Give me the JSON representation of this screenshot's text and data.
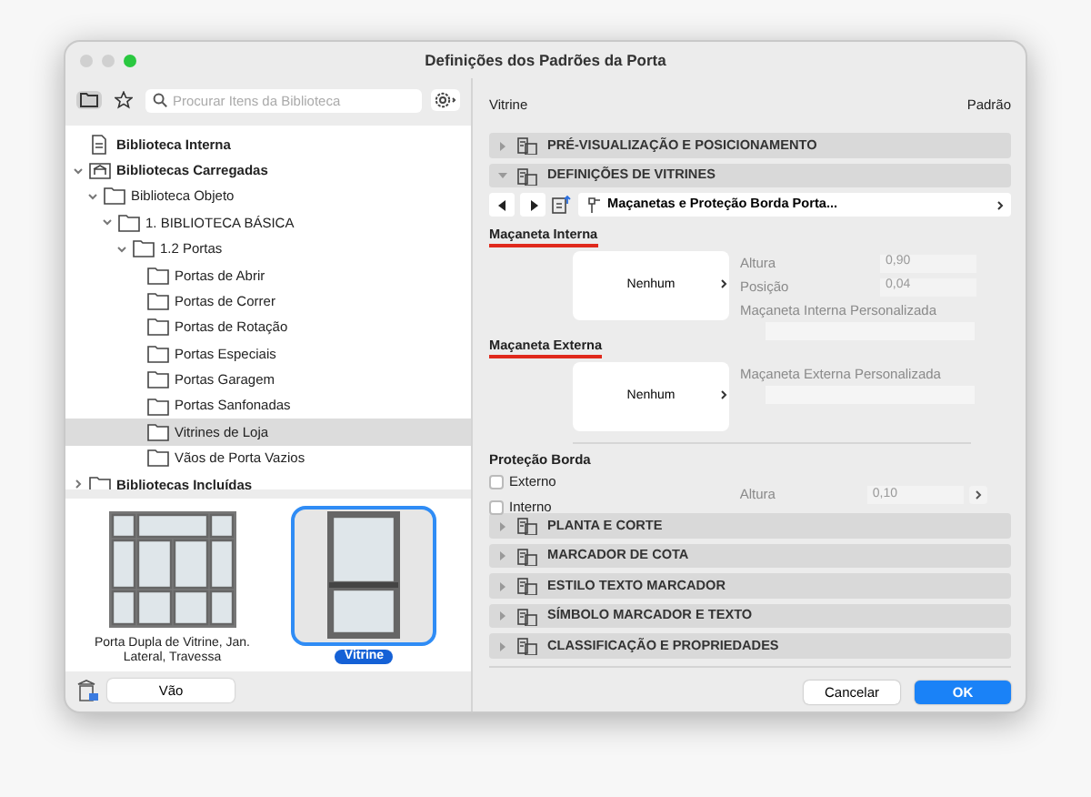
{
  "window": {
    "title": "Definições dos Padrões da Porta"
  },
  "library": {
    "search": {
      "placeholder": "Procurar Itens da Biblioteca"
    },
    "tree": [
      {
        "label": "Biblioteca Interna",
        "kind": "file",
        "bold": true,
        "selected": false
      },
      {
        "label": "Bibliotecas Carregadas",
        "kind": "library",
        "bold": true,
        "selected": false,
        "expanded": true,
        "children": [
          {
            "label": "Biblioteca Objeto",
            "kind": "folder",
            "bold": false,
            "selected": false,
            "expanded": true,
            "children": [
              {
                "label": "1. BIBLIOTECA BÁSICA",
                "kind": "folder",
                "bold": false,
                "selected": false,
                "expanded": true,
                "children": [
                  {
                    "label": "1.2 Portas",
                    "kind": "folder",
                    "bold": false,
                    "selected": false,
                    "expanded": true,
                    "children": [
                      {
                        "label": "Portas de Abrir",
                        "kind": "folder",
                        "bold": false,
                        "selected": false
                      },
                      {
                        "label": "Portas de Correr",
                        "kind": "folder",
                        "bold": false,
                        "selected": false
                      },
                      {
                        "label": "Portas de Rotação",
                        "kind": "folder",
                        "bold": false,
                        "selected": false
                      },
                      {
                        "label": "Portas Especiais",
                        "kind": "folder",
                        "bold": false,
                        "selected": false
                      },
                      {
                        "label": "Portas Garagem",
                        "kind": "folder",
                        "bold": false,
                        "selected": false
                      },
                      {
                        "label": "Portas Sanfonadas",
                        "kind": "folder",
                        "bold": false,
                        "selected": false
                      },
                      {
                        "label": "Vitrines de Loja",
                        "kind": "folder",
                        "bold": false,
                        "selected": true
                      },
                      {
                        "label": "Vãos de Porta Vazios",
                        "kind": "folder",
                        "bold": false,
                        "selected": false
                      }
                    ]
                  }
                ]
              }
            ]
          }
        ]
      },
      {
        "label": "Bibliotecas Incluídas",
        "kind": "folder",
        "bold": true,
        "selected": false,
        "expanded": false
      }
    ],
    "items": [
      {
        "caption": "Porta Dupla de Vitrine, Jan. Lateral, Travessa",
        "kind": "double",
        "selected": false
      },
      {
        "caption": "Vitrine",
        "kind": "single",
        "selected": true
      }
    ],
    "opening_button": "Vão"
  },
  "settings": {
    "name": "Vitrine",
    "default_label": "Padrão",
    "sections": [
      {
        "title": "PRÉ-VISUALIZAÇÃO E POSICIONAMENTO",
        "expanded": false
      },
      {
        "title": "DEFINIÇÕES DE VITRINES",
        "expanded": true
      },
      {
        "title": "PLANTA E CORTE",
        "expanded": false
      },
      {
        "title": "MARCADOR DE COTA",
        "expanded": false
      },
      {
        "title": "ESTILO TEXTO MARCADOR",
        "expanded": false
      },
      {
        "title": "SÍMBOLO MARCADOR E TEXTO",
        "expanded": false
      },
      {
        "title": "CLASSIFICAÇÃO E PROPRIEDADES",
        "expanded": false
      }
    ],
    "page_selector": "Maçanetas e Proteção Borda Porta...",
    "handles": [
      {
        "title": "Maçaneta Interna",
        "preview": "Nenhum",
        "fields": [
          {
            "label": "Altura",
            "value": "0,90",
            "disabled": true
          },
          {
            "label": "Posição",
            "value": "0,04",
            "disabled": true
          }
        ],
        "custom_label": "Maçaneta Interna Personalizada"
      },
      {
        "title": "Maçaneta Externa",
        "preview": "Nenhum",
        "custom_label": "Maçaneta Externa Personalizada"
      }
    ],
    "edge": {
      "title": "Proteção Borda",
      "options": [
        {
          "label": "Externo",
          "checked": false
        },
        {
          "label": "Interno",
          "checked": false
        }
      ],
      "field": {
        "label": "Altura",
        "value": "0,10",
        "disabled": true
      }
    }
  },
  "buttons": [
    {
      "label": "Cancelar",
      "kind": "secondary"
    },
    {
      "label": "OK",
      "kind": "primary"
    }
  ]
}
